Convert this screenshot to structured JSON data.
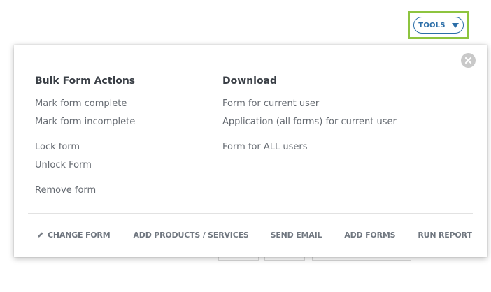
{
  "header": {
    "tools_label": "TOOLS"
  },
  "dropdown": {
    "bulk_actions": {
      "heading": "Bulk Form Actions",
      "items": [
        "Mark form complete",
        "Mark form incomplete",
        "Lock form",
        "Unlock Form",
        "Remove form"
      ]
    },
    "download": {
      "heading": "Download",
      "items": [
        "Form for current user",
        "Application (all forms) for current user",
        "Form for ALL users"
      ]
    },
    "footer": {
      "change_form": "CHANGE FORM",
      "add_products": "ADD PRODUCTS / SERVICES",
      "send_email": "SEND EMAIL",
      "add_forms": "ADD FORMS",
      "run_report": "RUN REPORT"
    }
  },
  "icons": {
    "tools_caret": "caret-down-icon",
    "close": "close-icon",
    "change_form": "pencil-icon"
  },
  "colors": {
    "accent_blue": "#2b6ea8",
    "highlight_green": "#8dc43f",
    "close_gray": "#c9c9c9"
  }
}
